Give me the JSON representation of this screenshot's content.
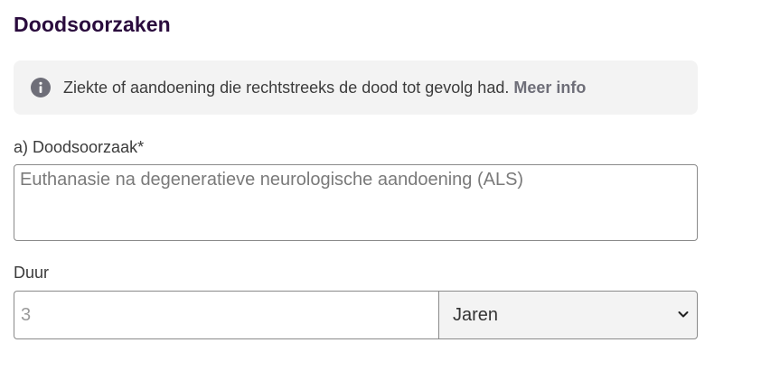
{
  "section": {
    "title": "Doodsoorzaken"
  },
  "info": {
    "icon": "info-icon",
    "text": "Ziekte of aandoening die rechtstreeks de dood tot gevolg had.",
    "link_label": "Meer info"
  },
  "cause_field": {
    "label": "a) Doodsoorzaak*",
    "value": "Euthanasie na degeneratieve neurologische aandoening (ALS)"
  },
  "duration_field": {
    "label": "Duur",
    "value": "3",
    "unit_selected": "Jaren"
  },
  "colors": {
    "heading": "#2a0b3d",
    "info_background": "#f3f3f3",
    "info_icon": "#6e6e78",
    "border": "#8a8a8a"
  }
}
